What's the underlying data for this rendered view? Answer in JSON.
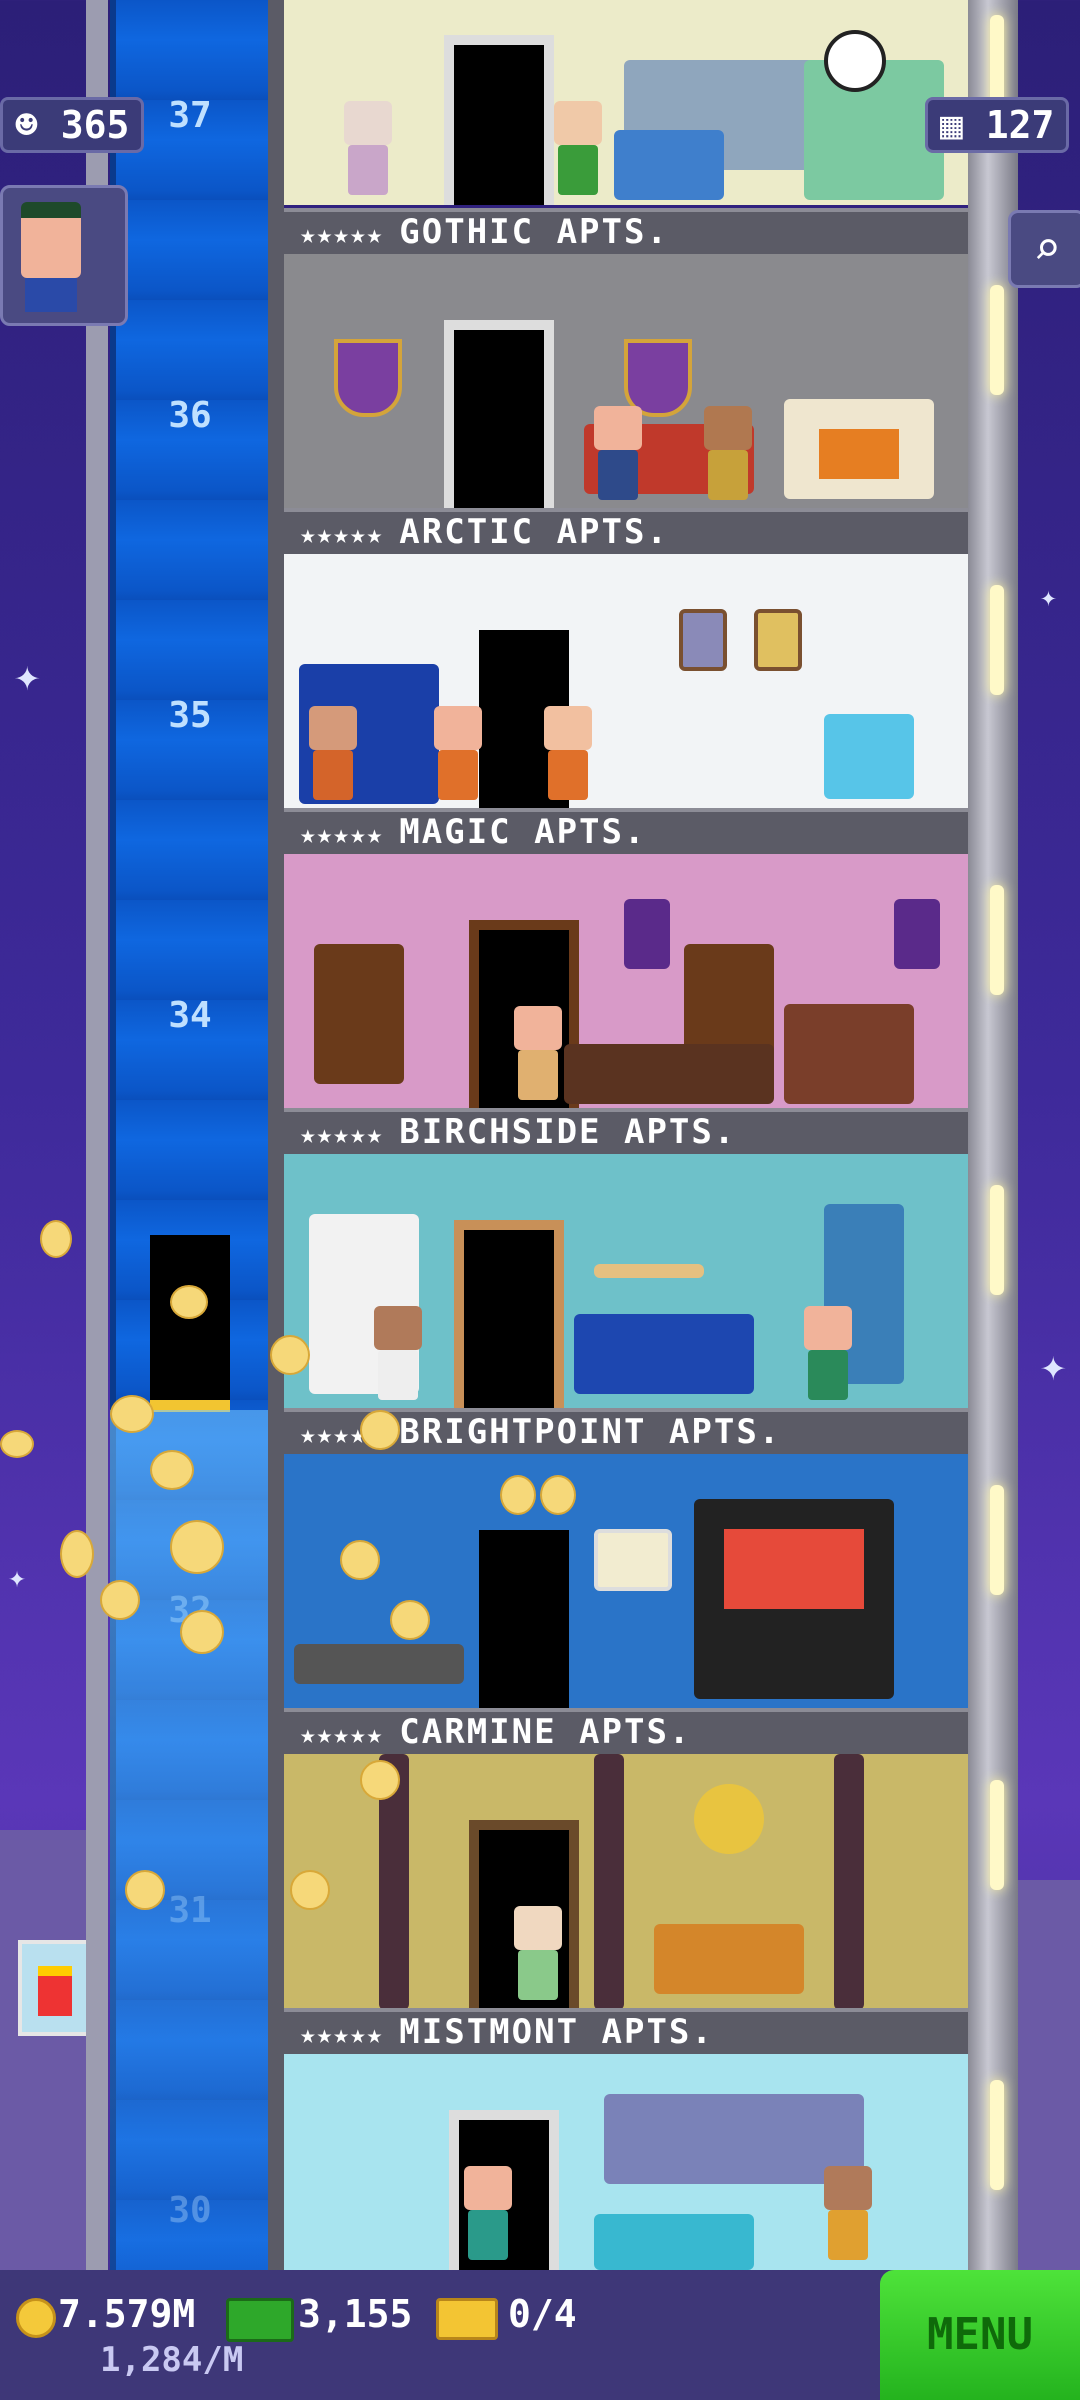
{
  "hud": {
    "population": "365",
    "floor_count": "127",
    "coins": "7.579M",
    "rate": "1,284/M",
    "bux": "3,155",
    "tickets": "0/4",
    "menu_label": "MENU"
  },
  "elevator": {
    "floor_numbers": [
      "37",
      "36",
      "35",
      "34",
      "32",
      "31",
      "30"
    ]
  },
  "floors": [
    {
      "label": "GOTHIC APTS."
    },
    {
      "label": "ARCTIC APTS."
    },
    {
      "label": "MAGIC APTS."
    },
    {
      "label": "BIRCHSIDE APTS."
    },
    {
      "label": "BRIGHTPOINT APTS."
    },
    {
      "label": "CARMINE APTS."
    },
    {
      "label": "MISTMONT APTS."
    }
  ],
  "rating_stars": "★★★★★",
  "icons": {
    "population": "person-icon",
    "floors": "building-icon",
    "search": "magnifier-icon",
    "coins": "coin-icon",
    "bux": "bux-icon",
    "tickets": "ticket-icon"
  },
  "colors": {
    "elevator": "#0f67e0",
    "menu": "#2ec72a",
    "bar": "#3e3778"
  }
}
